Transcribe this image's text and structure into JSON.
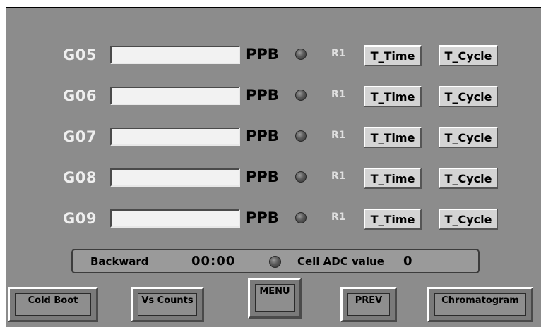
{
  "rows": [
    {
      "gas": "G05",
      "value": "",
      "unit": "PPB",
      "range": "R1",
      "time_btn": "T_Time",
      "cycle_btn": "T_Cycle"
    },
    {
      "gas": "G06",
      "value": "",
      "unit": "PPB",
      "range": "R1",
      "time_btn": "T_Time",
      "cycle_btn": "T_Cycle"
    },
    {
      "gas": "G07",
      "value": "",
      "unit": "PPB",
      "range": "R1",
      "time_btn": "T_Time",
      "cycle_btn": "T_Cycle"
    },
    {
      "gas": "G08",
      "value": "",
      "unit": "PPB",
      "range": "R1",
      "time_btn": "T_Time",
      "cycle_btn": "T_Cycle"
    },
    {
      "gas": "G09",
      "value": "",
      "unit": "PPB",
      "range": "R1",
      "time_btn": "T_Time",
      "cycle_btn": "T_Cycle"
    }
  ],
  "status": {
    "direction": "Backward",
    "time": "00:00",
    "adc_label": "Cell ADC value",
    "adc_value": "0"
  },
  "nav": {
    "cold_boot": "Cold Boot",
    "vs_counts": "Vs Counts",
    "menu": "MENU",
    "prev": "PREV",
    "chromatogram": "Chromatogram"
  },
  "colors": {
    "panel": "#8c8c8c",
    "led": "#5a5a5a"
  }
}
